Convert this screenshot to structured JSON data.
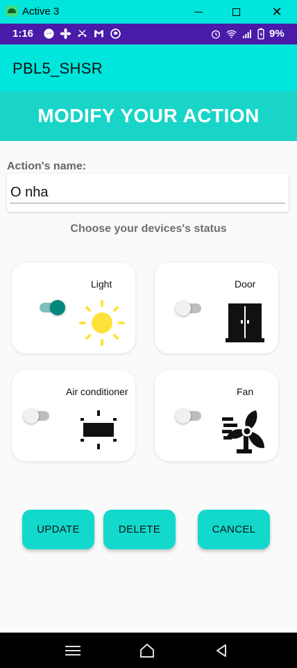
{
  "window": {
    "title": "Active 3",
    "icon": "android-app-icon"
  },
  "status_bar": {
    "time": "1:16",
    "notification_icons": [
      "messenger-icon",
      "fan-app-icon",
      "missed-call-icon",
      "gmail-icon",
      "app-notification-icon"
    ],
    "system_icons": [
      "alarm-icon",
      "wifi-icon",
      "signal-icon",
      "battery-icon"
    ],
    "battery": "9%"
  },
  "app_bar": {
    "title": "PBL5_SHSR"
  },
  "header": {
    "title": "MODIFY YOUR ACTION"
  },
  "form": {
    "name_label": "Action's name:",
    "name_value": "O nha",
    "devices_subtitle": "Choose your devices's status"
  },
  "devices": [
    {
      "label": "Light",
      "on": true,
      "icon": "sun-icon"
    },
    {
      "label": "Door",
      "on": false,
      "icon": "door-icon"
    },
    {
      "label": "Air conditioner",
      "on": false,
      "icon": "air-conditioner-icon"
    },
    {
      "label": "Fan",
      "on": false,
      "icon": "fan-icon"
    }
  ],
  "buttons": {
    "update": "UPDATE",
    "delete": "DELETE",
    "cancel": "CANCEL"
  },
  "colors": {
    "teal_primary": "#00e5dc",
    "header_teal": "#18d5c8",
    "status_purple": "#4a1aa8",
    "toggle_on": "#00897b",
    "sun_yellow": "#fde23b"
  },
  "nav_bar": {
    "icons": [
      "recents-icon",
      "home-icon",
      "back-icon"
    ]
  }
}
